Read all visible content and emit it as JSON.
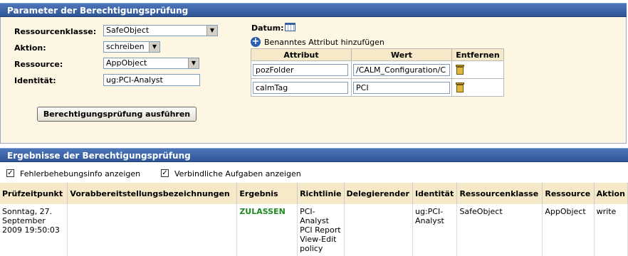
{
  "params_panel": {
    "title": "Parameter der Berechtigungsprüfung",
    "resource_class": {
      "label": "Ressourcenklasse:",
      "value": "SafeObject"
    },
    "action": {
      "label": "Aktion:",
      "value": "schreiben"
    },
    "resource": {
      "label": "Ressource:",
      "value": "AppObject"
    },
    "identity": {
      "label": "Identität:",
      "value": "ug:PCI-Analyst"
    },
    "date_label": "Datum:",
    "add_attribute_label": "Benanntes Attribut hinzufügen",
    "attribute_table": {
      "headers": [
        "Attribut",
        "Wert",
        "Entfernen"
      ],
      "rows": [
        {
          "attribute": "pozFolder",
          "value": "/CALM_Configuration/C"
        },
        {
          "attribute": "calmTag",
          "value": "PCI"
        }
      ]
    },
    "run_button": "Berechtigungsprüfung ausführen"
  },
  "results_panel": {
    "title": "Ergebnisse der Berechtigungsprüfung",
    "debug_checkbox": {
      "label": "Fehlerbehebungsinfo anzeigen",
      "checked": true
    },
    "obligations_checkbox": {
      "label": "Verbindliche Aufgaben anzeigen",
      "checked": true
    },
    "table": {
      "headers": [
        "Prüfzeitpunkt",
        "Vorabbereitstellungsbezeichnungen",
        "Ergebnis",
        "Richtlinie",
        "Delegierender",
        "Identität",
        "Ressourcenklasse",
        "Ressource",
        "Aktion"
      ],
      "rows": [
        {
          "time": "Sonntag, 27. September 2009 19:50:03",
          "provisioning": "",
          "result": "ZULASSEN",
          "policy": "PCI-Analyst PCI Report View-Edit policy",
          "delegator": "",
          "identity": "ug:PCI-Analyst",
          "resource_class": "SafeObject",
          "resource": "AppObject",
          "action": "write"
        }
      ]
    }
  },
  "colors": {
    "header_blue": "#2f5597",
    "panel_bg": "#fdf6e3",
    "allow_green": "#1e8a1e"
  }
}
